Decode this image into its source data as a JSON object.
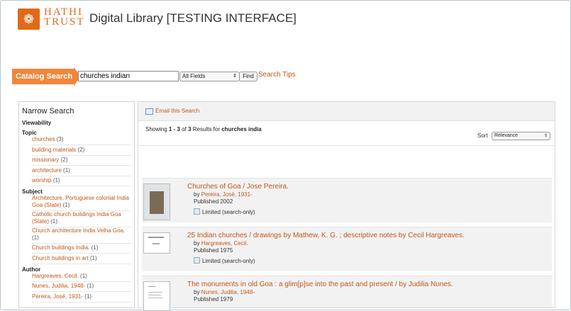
{
  "header": {
    "brand_line1": "HATHI",
    "brand_line2": "TRUST",
    "app_title": "Digital Library [TESTING INTERFACE]"
  },
  "search": {
    "label": "Catalog Search",
    "query": "churches indian",
    "field": "All Fields",
    "find_label": "Find",
    "tips_label": "Search Tips"
  },
  "narrow": {
    "title": "Narrow Search",
    "viewability_label": "Viewability",
    "topic_label": "Topic",
    "topics": [
      {
        "label": "churches",
        "count": "(3)"
      },
      {
        "label": "building materials",
        "count": "(2)"
      },
      {
        "label": "missionary",
        "count": "(2)"
      },
      {
        "label": "architecture",
        "count": "(1)"
      },
      {
        "label": "worship",
        "count": "(1)"
      }
    ],
    "subject_label": "Subject",
    "subjects": [
      {
        "label": "Architecture, Portuguese colonial India Goa (State)",
        "count": "(1)"
      },
      {
        "label": "Catholic church buildings India Goa (State)",
        "count": "(1)"
      },
      {
        "label": "Church architecture India Velha Goa.",
        "count": "(1)"
      },
      {
        "label": "Church buildings India.",
        "count": "(1)"
      },
      {
        "label": "Church buildings in art",
        "count": "(1)"
      }
    ],
    "author_label": "Author",
    "authors": [
      {
        "label": "Hargreaves, Cecil.",
        "count": "(1)"
      },
      {
        "label": "Nunes, Judilia, 1948-",
        "count": "(1)"
      },
      {
        "label": "Pereira, José, 1931-",
        "count": "(1)"
      }
    ]
  },
  "main": {
    "email_label": "Email this Search",
    "showing_prefix": "Showing",
    "range": "1 - 3",
    "of_word": "of",
    "total": "3",
    "results_for": "Results for",
    "query_echo": "churches india",
    "sort_label": "Sort",
    "sort_value": "Relevance",
    "by_word": "by",
    "results": [
      {
        "title": "Churches of Goa / Jose Pereira.",
        "author": "Pereira, José, 1931-",
        "published": "Published 2002",
        "availability": "Limited (search-only)"
      },
      {
        "title": "25 Indian churches / drawings by Mathew, K. G. ; descriptive notes by Cecil Hargreaves.",
        "author": "Hargreaves, Cecil.",
        "published": "Published 1975",
        "availability": "Limited (search-only)"
      },
      {
        "title": "The monuments in old Goa : a glim[p]se into the past and present / by Judilia Nunes.",
        "author": "Nunes, Judilia, 1948-",
        "published": "Published 1979",
        "availability": ""
      }
    ]
  }
}
